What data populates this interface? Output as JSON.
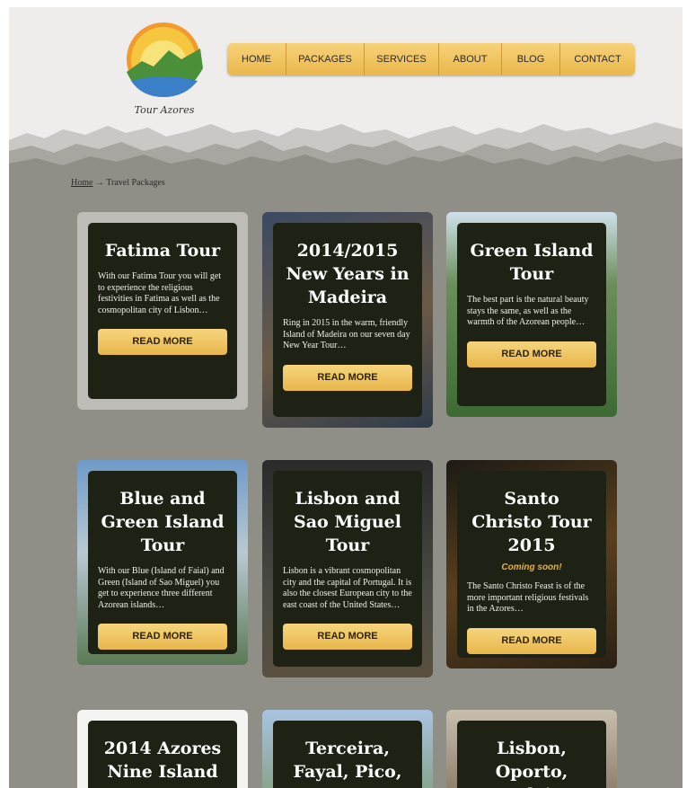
{
  "logo": {
    "text": "Tour Azores"
  },
  "nav": [
    "HOME",
    "PACKAGES",
    "SERVICES",
    "ABOUT",
    "BLOG",
    "CONTACT"
  ],
  "breadcrumb": {
    "home": "Home",
    "separator": "→",
    "current": "Travel Packages"
  },
  "cards": [
    {
      "title": "Fatima Tour",
      "description": "With our Fatima Tour you will get to experience the religious festivities in Fatima as well as the cosmopolitan city of Lisbon…",
      "button": "READ MORE"
    },
    {
      "title": "2014/2015 New Years in Madeira",
      "description": "Ring in 2015 in the warm, friendly Island of Madeira on our seven day New Year Tour…",
      "button": "READ MORE"
    },
    {
      "title": "Green Island Tour",
      "description": "The best part is the natural beauty stays the same, as well as the warmth of the Azorean people…",
      "button": "READ MORE"
    },
    {
      "title": "Blue and Green Island Tour",
      "description": "With our Blue (Island of Faial) and Green (Island of Sao Miguel) you get to experience three different Azorean islands…",
      "button": "READ MORE"
    },
    {
      "title": "Lisbon and Sao Miguel Tour",
      "description": "Lisbon is a vibrant cosmopolitan city and the capital of Portugal. It is also the closest European city to the east coast of the United States…",
      "button": "READ MORE"
    },
    {
      "title": "Santo Christo Tour 2015",
      "subtitle": "Coming soon!",
      "description": "The Santo Christo Feast is of the more important religious festivals in the Azores…",
      "button": "READ MORE"
    },
    {
      "title": "2014 Azores Nine Island"
    },
    {
      "title": "Terceira, Fayal, Pico, Sao Jorge"
    },
    {
      "title": "Lisbon, Oporto, Madeira"
    }
  ],
  "colors": {
    "background": "#8f8f88",
    "nav_gold": "#eab74a",
    "card_inner": "#1e2214",
    "accent": "#e8b13c"
  }
}
